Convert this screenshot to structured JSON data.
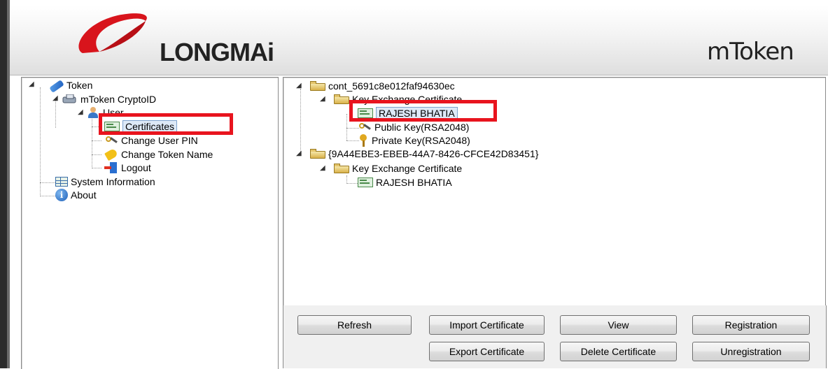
{
  "header": {
    "logo_text": "LONGMAi",
    "brand_text": "mToken",
    "colors": {
      "logo_red": "#d8141c",
      "highlight_red": "#e8141e"
    }
  },
  "left_tree": {
    "token": "Token",
    "device": "mToken CryptoID",
    "user": "User",
    "certificates": "Certificates",
    "change_user_pin": "Change User PIN",
    "change_token_name": "Change Token Name",
    "logout": "Logout",
    "system_information": "System Information",
    "about": "About"
  },
  "right_tree": {
    "container1": "cont_5691c8e012faf94630ec",
    "container1_key_exchange": "Key Exchange Certificate",
    "container1_cert": "RAJESH BHATIA",
    "public_key": "Public Key(RSA2048)",
    "private_key": "Private Key(RSA2048)",
    "container2": "{9A44EBE3-EBEB-44A7-8426-CFCE42D83451}",
    "container2_key_exchange": "Key Exchange Certificate",
    "container2_cert": "RAJESH BHATIA"
  },
  "buttons": {
    "refresh": "Refresh",
    "import_certificate": "Import Certificate",
    "view": "View",
    "registration": "Registration",
    "export_certificate": "Export Certificate",
    "delete_certificate": "Delete Certificate",
    "unregistration": "Unregistration"
  }
}
